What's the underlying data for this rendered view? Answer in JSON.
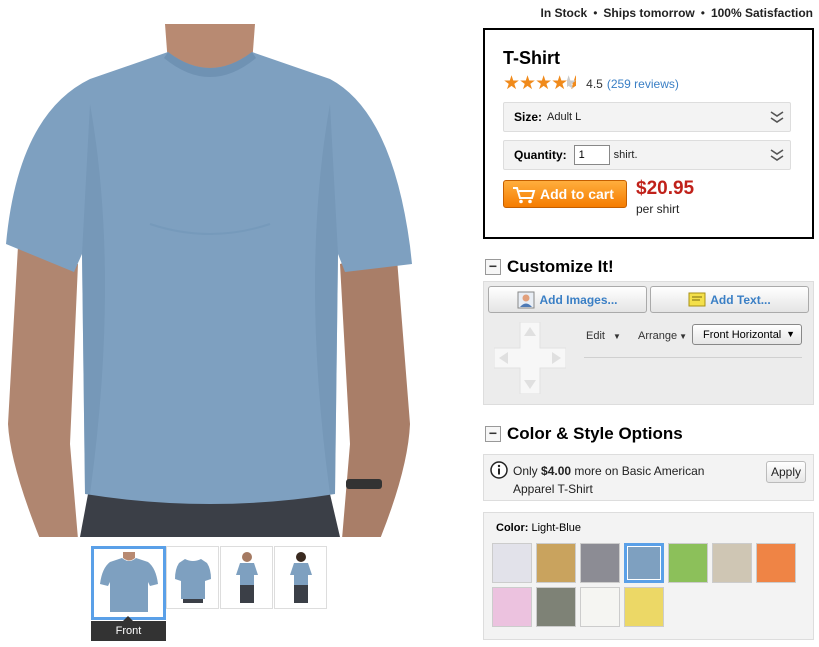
{
  "status": {
    "in_stock": "In Stock",
    "sep1": "•",
    "ships": "Ships tomorrow",
    "sep2": "•",
    "satisfaction": "100% Satisfaction"
  },
  "product": {
    "title": "T-Shirt",
    "rating_value": "4.5",
    "rating_stars": 4.5,
    "reviews": "(259 reviews)",
    "size_label": "Size:",
    "size_value": "Adult L",
    "quantity_label": "Quantity:",
    "quantity_value": "1",
    "quantity_unit": "shirt.",
    "add_to_cart": "Add to cart",
    "price": "$20.95",
    "price_unit": "per shirt",
    "shirt_color": "#7ea0c0"
  },
  "thumbnails": {
    "selected_label": "Front"
  },
  "customize": {
    "header": "Customize It!",
    "collapse": "−",
    "add_images": "Add Images...",
    "add_text": "Add Text...",
    "edit": "Edit",
    "arrange": "Arrange",
    "face_select": "Front Horizontal"
  },
  "color_style": {
    "header": "Color & Style Options",
    "collapse": "−",
    "upsell_prefix": "Only ",
    "upsell_price": "$4.00",
    "upsell_suffix": " more on Basic American Apparel T-Shirt",
    "apply": "Apply",
    "color_label": "Color:",
    "color_value": "Light-Blue",
    "swatches": [
      "#e2e2ea",
      "#c9a35e",
      "#8c8c94",
      "#7ea0c0",
      "#8cc05a",
      "#cfc6b4",
      "#ef8445",
      "#ecc2df",
      "#7e8276",
      "#f5f5f2",
      "#ecd866"
    ],
    "selected_swatch_index": 3
  }
}
